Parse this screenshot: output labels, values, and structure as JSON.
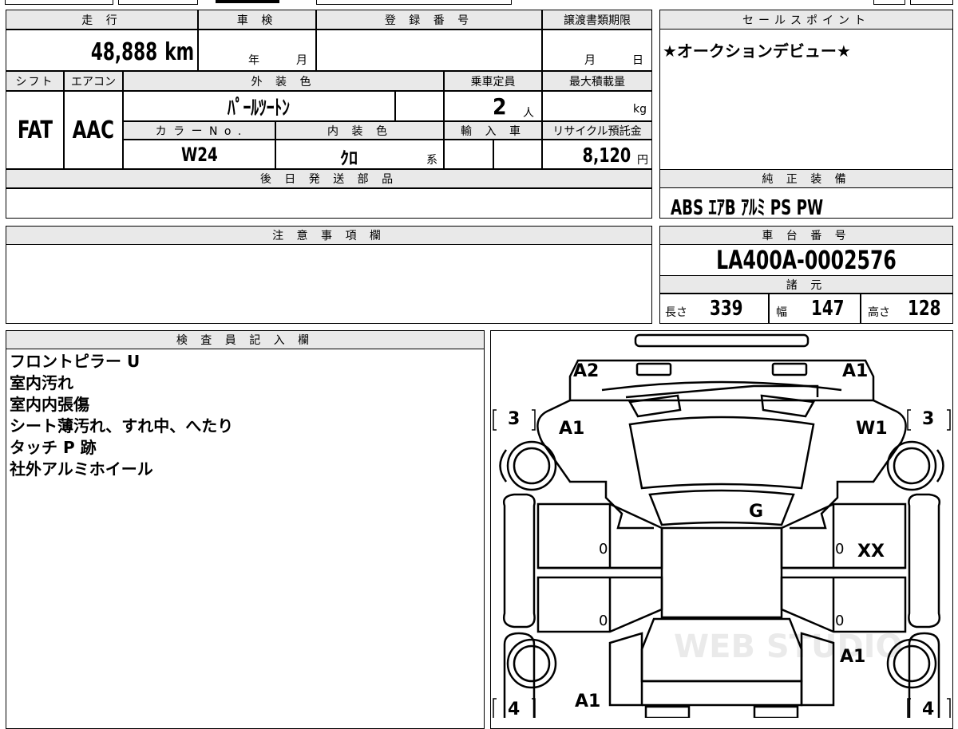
{
  "mileage": {
    "label": "走 行",
    "value": "48,888",
    "unit": "km"
  },
  "inspection": {
    "label": "車 検",
    "year_unit": "年",
    "month_unit": "月"
  },
  "registration": {
    "label": "登 録 番 号",
    "value": ""
  },
  "transfer_deadline": {
    "label": "譲渡書類期限",
    "month_unit": "月",
    "day_unit": "日"
  },
  "sales_point": {
    "label": "セールスポイント",
    "text": "★オークションデビュー★"
  },
  "shift": {
    "label": "シフト",
    "value": "FAT"
  },
  "aircon": {
    "label": "エアコン",
    "value": "AAC"
  },
  "exterior_color": {
    "label": "外 装 色",
    "value": "ﾊﾟｰﾙﾂｰﾄﾝ"
  },
  "capacity": {
    "label": "乗車定員",
    "value": "2",
    "unit": "人"
  },
  "max_load": {
    "label": "最大積載量",
    "unit": "kg"
  },
  "color_no": {
    "label": "カ ラ ー N o .",
    "value": "W24"
  },
  "interior_color": {
    "label": "内 装 色",
    "value": "ｸﾛ",
    "suffix": "系"
  },
  "import": {
    "label": "輸 入 車"
  },
  "recycle": {
    "label": "リサイクル預託金",
    "value": "8,120",
    "unit": "円"
  },
  "later_parts": {
    "label": "後 日 発 送 部 品"
  },
  "standard_equipment": {
    "label": "純 正 装 備",
    "value": "ABS ｴｱB ｱﾙﾐ PS PW"
  },
  "notes": {
    "label": "注 意 事 項 欄"
  },
  "chassis": {
    "label": "車 台 番 号",
    "value": "LA400A-0002576"
  },
  "specs": {
    "label": "諸 元",
    "length_label": "長さ",
    "length": "339",
    "width_label": "幅",
    "width": "147",
    "height_label": "高さ",
    "height": "128"
  },
  "inspector": {
    "label": "検 査 員 記 入 欄",
    "lines": [
      "フロントピラー U",
      "室内汚れ",
      "室内内張傷",
      "シート薄汚れ、すれ中、へたり",
      "タッチ P 跡",
      "社外アルミホイール"
    ]
  },
  "diagram": {
    "front_left": "A2",
    "front_right": "A1",
    "left_front_fender": "A1",
    "right_front_fender": "W1",
    "roof": "G",
    "right_front_door_mark": "XX",
    "door_zero_1": "0",
    "door_zero_2": "0",
    "door_zero_3": "0",
    "door_zero_4": "0",
    "right_rear": "A1",
    "left_rear": "A1",
    "tire_fl": "3",
    "tire_fr": "3",
    "tire_rl": "4",
    "tire_rr": "4",
    "watermark": "WEB STUDIO"
  }
}
